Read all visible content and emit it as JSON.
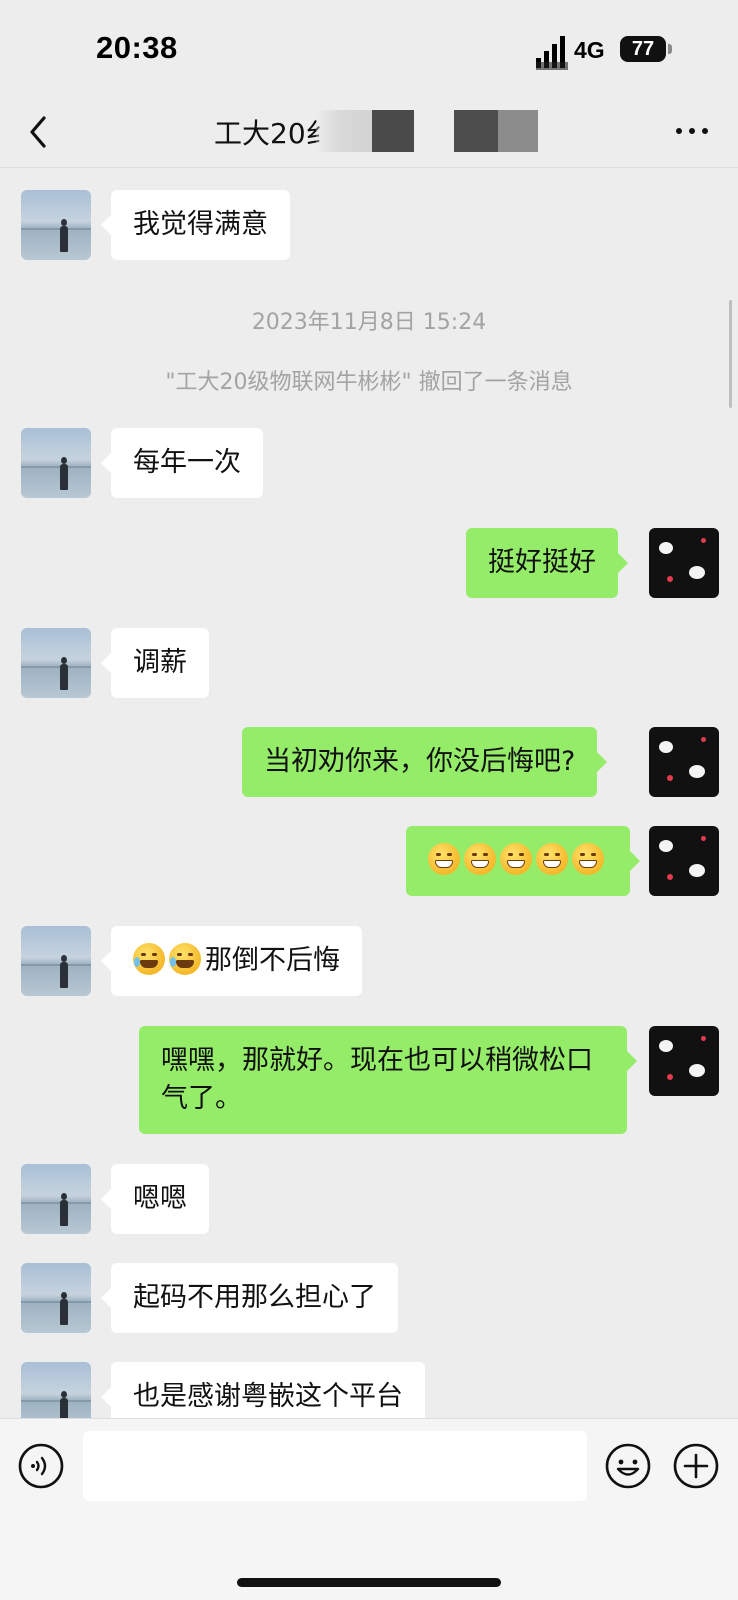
{
  "status_bar": {
    "time": "20:38",
    "network": "4G",
    "battery": "77"
  },
  "nav": {
    "title": "工大20纟",
    "back_icon": "chevron-left-icon",
    "more_icon": "ellipsis-icon"
  },
  "messages": {
    "m1": "我觉得满意",
    "timestamp": "2023年11月8日 15:24",
    "recall_notice": "\"工大20级物联网牛彬彬\" 撤回了一条消息",
    "m2": "每年一次",
    "m3": "挺好挺好",
    "m4": "调薪",
    "m5": "当初劝你来，你没后悔吧?",
    "m6_emoji": "grinning-face-emoji x5",
    "m7_text": "那倒不后悔",
    "m7_emoji": "rolling-on-floor-laughing-emoji x2",
    "m8": "嘿嘿，那就好。现在也可以稍微松口气了。",
    "m9": "嗯嗯",
    "m10": "起码不用那么担心了",
    "m11": "也是感谢粤嵌这个平台"
  },
  "input_bar": {
    "placeholder": "",
    "voice_icon": "voice-icon",
    "emoji_icon": "smiley-icon",
    "plus_icon": "plus-icon"
  },
  "colors": {
    "background": "#ededed",
    "bubble_out": "#95ec69",
    "bubble_in": "#ffffff",
    "meta_text": "#a3a3a3"
  }
}
